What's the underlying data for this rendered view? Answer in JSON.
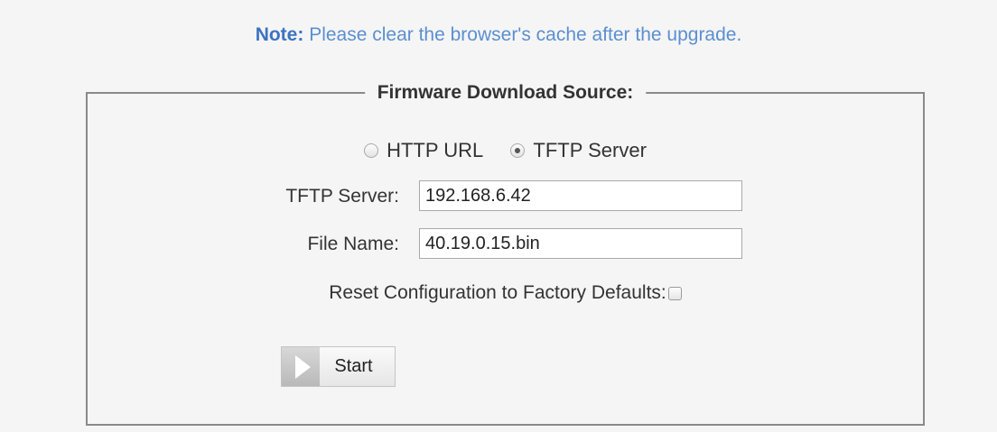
{
  "note": {
    "prefix": "Note:",
    "text": " Please clear the browser's cache after the upgrade."
  },
  "source": {
    "legend": "Firmware Download Source:",
    "options": [
      {
        "label": "HTTP URL",
        "selected": false
      },
      {
        "label": "TFTP Server",
        "selected": true
      }
    ]
  },
  "fields": {
    "tftp_server": {
      "label": "TFTP Server:",
      "value": "192.168.6.42"
    },
    "file_name": {
      "label": "File Name:",
      "value": "40.19.0.15.bin"
    }
  },
  "reset": {
    "label": "Reset Configuration to Factory Defaults:",
    "checked": false
  },
  "actions": {
    "start_label": "Start",
    "start_icon": "play-icon"
  },
  "colors": {
    "note_text": "#5b8fd1",
    "note_prefix": "#3c73c1"
  }
}
